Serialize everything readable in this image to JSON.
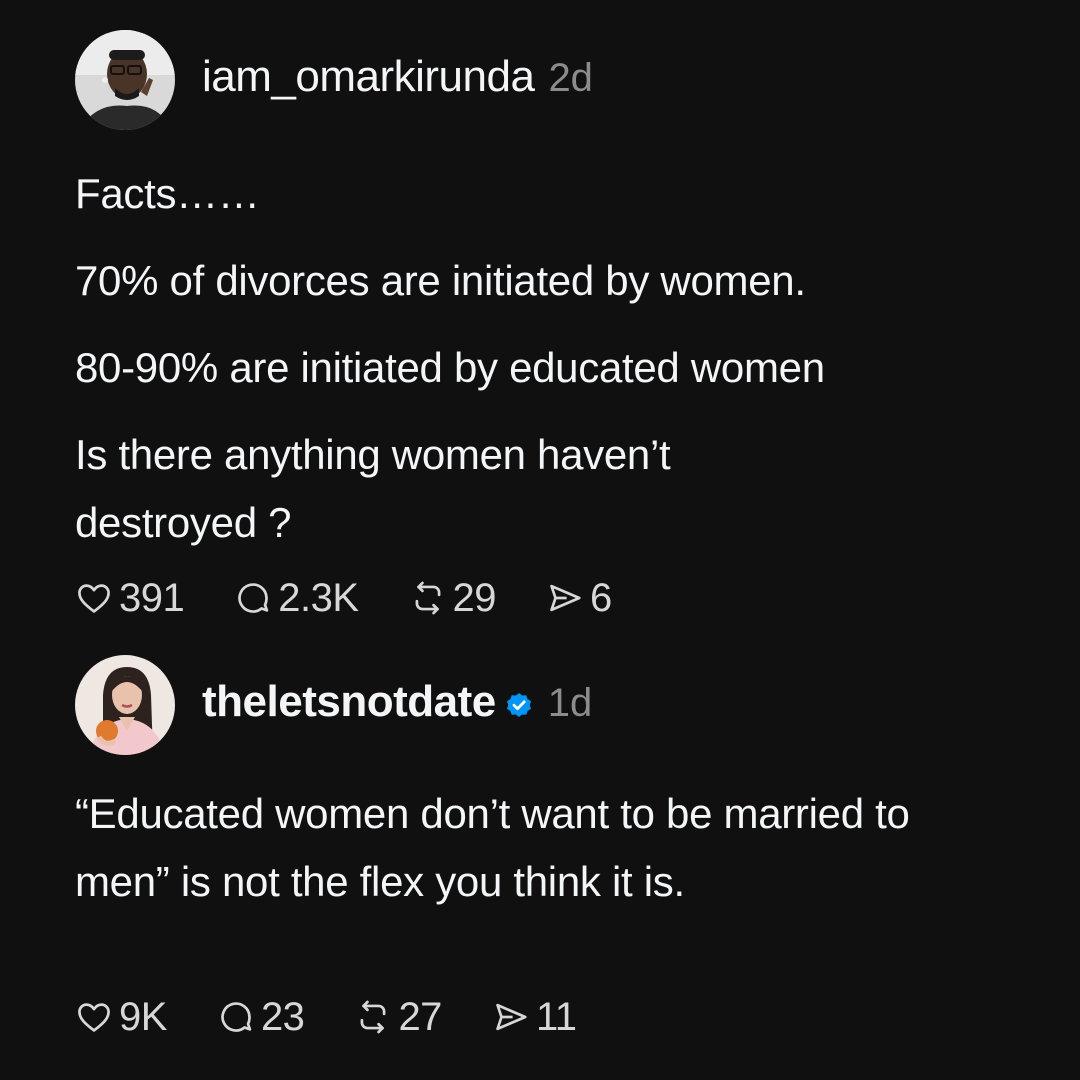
{
  "posts": [
    {
      "username": "iam_omarkirunda",
      "time": "2d",
      "verified": false,
      "paragraphs": [
        "Facts……",
        "70% of divorces are initiated by women.",
        "80-90% are initiated by educated women",
        "Is there anything women haven’t destroyed ?"
      ],
      "stats": {
        "likes": "391",
        "replies": "2.3K",
        "reposts": "29",
        "shares": "6"
      }
    },
    {
      "username": "theletsnotdate",
      "time": "1d",
      "verified": true,
      "paragraphs": [
        "“Educated women don’t want to be married to men” is not the flex you think it is."
      ],
      "stats": {
        "likes": "9K",
        "replies": "23",
        "reposts": "27",
        "shares": "11"
      }
    }
  ],
  "colors": {
    "background": "#101010",
    "text": "#f3f5f7",
    "muted": "#8c8c8c",
    "verified": "#0095f6"
  },
  "icons": [
    "heart-icon",
    "comment-icon",
    "repost-icon",
    "share-icon",
    "verified-badge-icon"
  ]
}
